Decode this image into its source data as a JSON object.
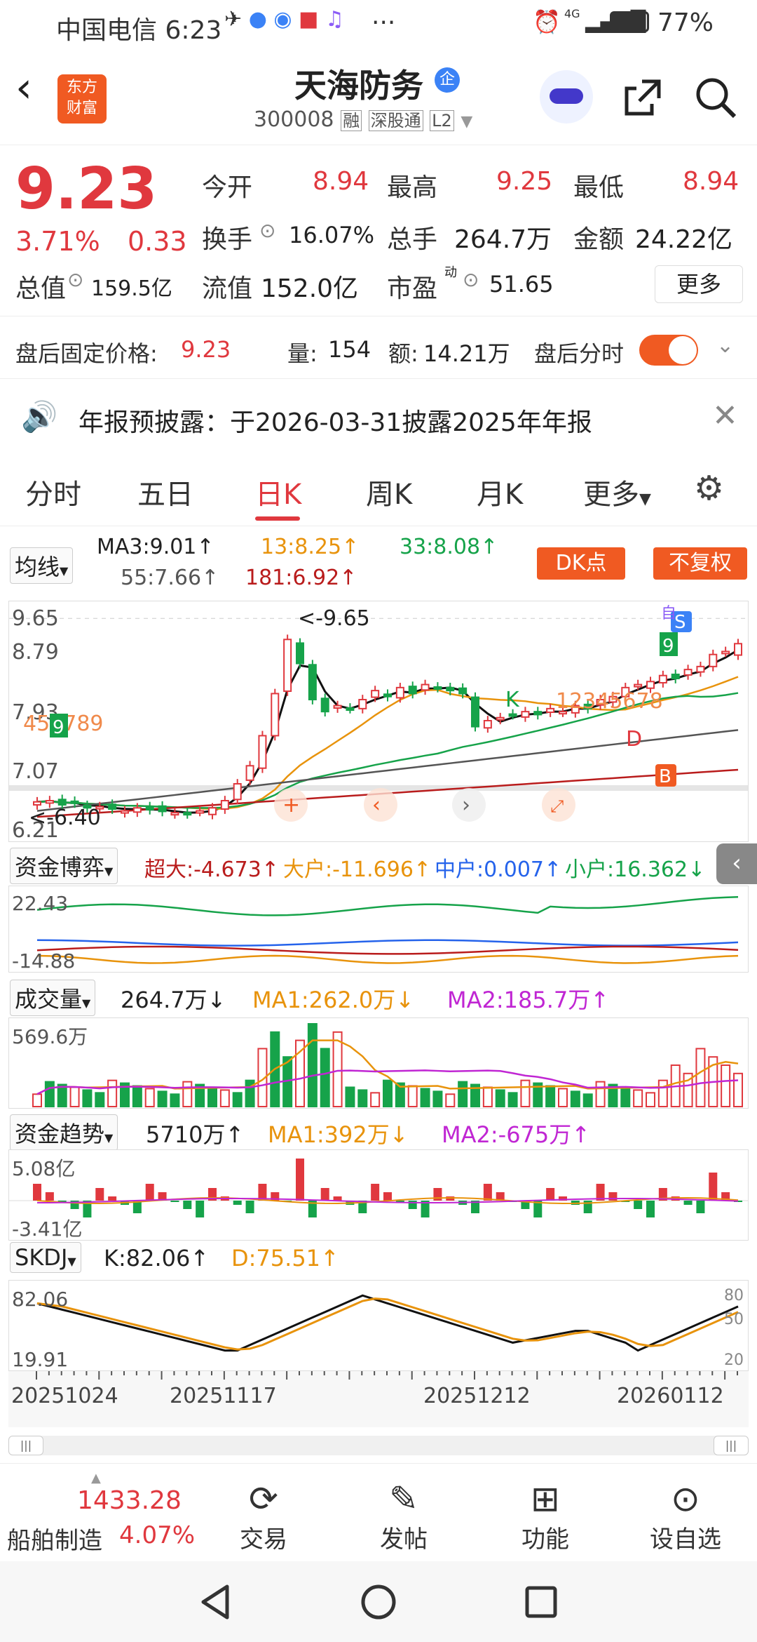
{
  "status_bar": {
    "carrier_time": "中国电信 6:23",
    "battery": "77%",
    "network": "4G",
    "dots": "···"
  },
  "header": {
    "logo": "东方\n财富",
    "stock_name": "天海防务",
    "enterprise_badge": "企",
    "code": "300008",
    "tag_rong": "融",
    "tag_sgt": "深股通",
    "tag_l2": "L2"
  },
  "quote": {
    "price": "9.23",
    "change_pct": "3.71%",
    "change_amt": "0.33",
    "open_label": "今开",
    "open": "8.94",
    "high_label": "最高",
    "high": "9.25",
    "low_label": "最低",
    "low": "8.94",
    "turnover_label": "换手",
    "turnover": "16.07%",
    "volume_label": "总手",
    "volume": "264.7万",
    "amount_label": "金额",
    "amount": "24.22亿",
    "mktcap_label": "总值",
    "mktcap": "159.5亿",
    "float_label": "流值",
    "float": "152.0亿",
    "pe_label": "市盈",
    "pe_sup": "动",
    "pe": "51.65",
    "more_button": "更多"
  },
  "afterhours": {
    "price_label": "盘后固定价格:",
    "price": "9.23",
    "vol_label": "量:",
    "vol": "154",
    "amt_label": "额:",
    "amt": "14.21万",
    "toggle_label": "盘后分时"
  },
  "notice": {
    "text": "年报预披露：于2026-03-31披露2025年年报"
  },
  "tabs": [
    "分时",
    "五日",
    "日K",
    "周K",
    "月K",
    "更多"
  ],
  "ma_bar": {
    "select": "均线",
    "ma3": "MA3:9.01↑",
    "ma13": "13:8.25↑",
    "ma33": "33:8.08↑",
    "ma55": "55:7.66↑",
    "ma181": "181:6.92↑",
    "dk_button": "DK点",
    "fq_button": "不复权"
  },
  "kline": {
    "y_labels": [
      "9.65",
      "8.79",
      "7.93",
      "7.07",
      "6.21"
    ],
    "high_marker": "<-9.65",
    "low_marker": "<-6.40",
    "signal_k": "K",
    "signal_d": "D",
    "signal_b": "B",
    "signal_s": "S",
    "signal_zi": "自",
    "seq_left": "456789",
    "seq_right": "12345678",
    "seq_9": "9"
  },
  "fund_game": {
    "select": "资金博弈",
    "super": "超大:-4.673↑",
    "large": "大户:-11.696↑",
    "medium": "中户:0.007↑",
    "small": "小户:16.362↓",
    "y_top": "22.43",
    "y_bottom": "-14.88"
  },
  "volume": {
    "select": "成交量",
    "value": "264.7万↓",
    "ma1": "MA1:262.0万↓",
    "ma2": "MA2:185.7万↑",
    "y_top": "569.6万"
  },
  "fund_trend": {
    "select": "资金趋势",
    "value": "5710万↑",
    "ma1": "MA1:392万↓",
    "ma2": "MA2:-675万↑",
    "y_top": "5.08亿",
    "y_bottom": "-3.41亿"
  },
  "skdj": {
    "select": "SKDJ",
    "k": "K:82.06↑",
    "d": "D:75.51↑",
    "y_top": "82.06",
    "y_bottom": "19.91",
    "r80": "80",
    "r50": "50",
    "r20": "20"
  },
  "dates": [
    "20251024",
    "20251117",
    "20251212",
    "20260112"
  ],
  "bottom_nav": {
    "index_value": "1433.28",
    "index_name": "船舶制造",
    "index_pct": "4.07%",
    "trade": "交易",
    "post": "发帖",
    "func": "功能",
    "custom": "设自选"
  },
  "colors": {
    "up": "#e0383e",
    "down": "#16a34a",
    "accent": "#f05a22"
  }
}
